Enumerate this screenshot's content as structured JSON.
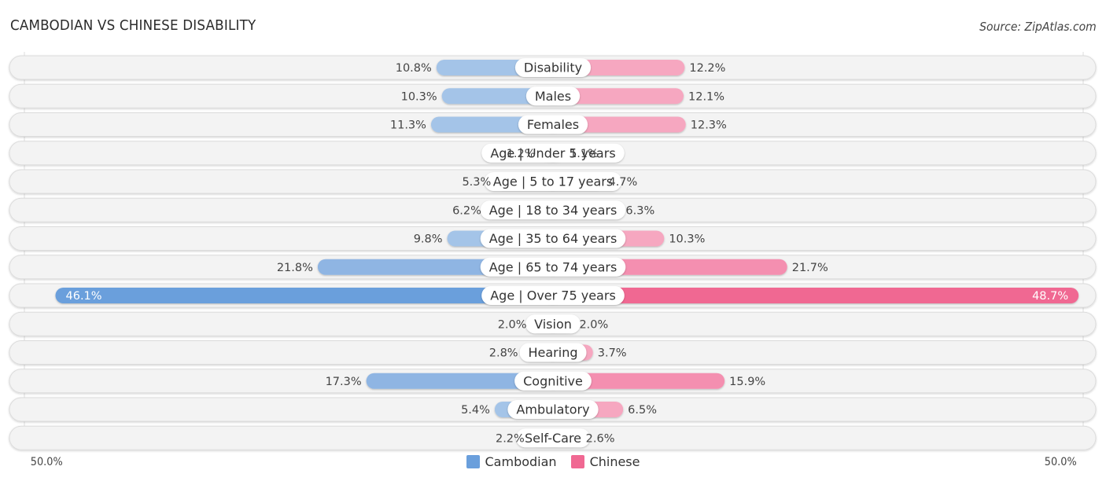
{
  "header": {
    "title": "CAMBODIAN VS CHINESE DISABILITY",
    "source": "Source: ZipAtlas.com"
  },
  "axis": {
    "left_label": "50.0%",
    "right_label": "50.0%"
  },
  "legend": [
    {
      "name": "Cambodian",
      "color": "#6a9fdc"
    },
    {
      "name": "Chinese",
      "color": "#f06892"
    }
  ],
  "colors": {
    "cambodian_light": "#a4c4e8",
    "cambodian_dark": "#6a9fdc",
    "chinese_light": "#f6a7c0",
    "chinese_dark": "#f06892",
    "track": "#f3f3f3"
  },
  "chart_data": {
    "type": "bar",
    "orientation": "horizontal-diverging",
    "title": "CAMBODIAN VS CHINESE DISABILITY",
    "xlabel": "",
    "ylabel": "",
    "xlim": [
      -50,
      50
    ],
    "tick_labels": [
      "50.0%",
      "50.0%"
    ],
    "legend_position": "bottom-center",
    "categories": [
      "Disability",
      "Males",
      "Females",
      "Age | Under 5 years",
      "Age | 5 to 17 years",
      "Age | 18 to 34 years",
      "Age | 35 to 64 years",
      "Age | 65 to 74 years",
      "Age | Over 75 years",
      "Vision",
      "Hearing",
      "Cognitive",
      "Ambulatory",
      "Self-Care"
    ],
    "series": [
      {
        "name": "Cambodian",
        "side": "left",
        "values": [
          10.8,
          10.3,
          11.3,
          1.2,
          5.3,
          6.2,
          9.8,
          21.8,
          46.1,
          2.0,
          2.8,
          17.3,
          5.4,
          2.2
        ],
        "labels": [
          "10.8%",
          "10.3%",
          "11.3%",
          "1.2%",
          "5.3%",
          "6.2%",
          "9.8%",
          "21.8%",
          "46.1%",
          "2.0%",
          "2.8%",
          "17.3%",
          "5.4%",
          "2.2%"
        ]
      },
      {
        "name": "Chinese",
        "side": "right",
        "values": [
          12.2,
          12.1,
          12.3,
          1.1,
          4.7,
          6.3,
          10.3,
          21.7,
          48.7,
          2.0,
          3.7,
          15.9,
          6.5,
          2.6
        ],
        "labels": [
          "12.2%",
          "12.1%",
          "12.3%",
          "1.1%",
          "4.7%",
          "6.3%",
          "10.3%",
          "21.7%",
          "48.7%",
          "2.0%",
          "3.7%",
          "15.9%",
          "6.5%",
          "2.6%"
        ]
      }
    ]
  }
}
